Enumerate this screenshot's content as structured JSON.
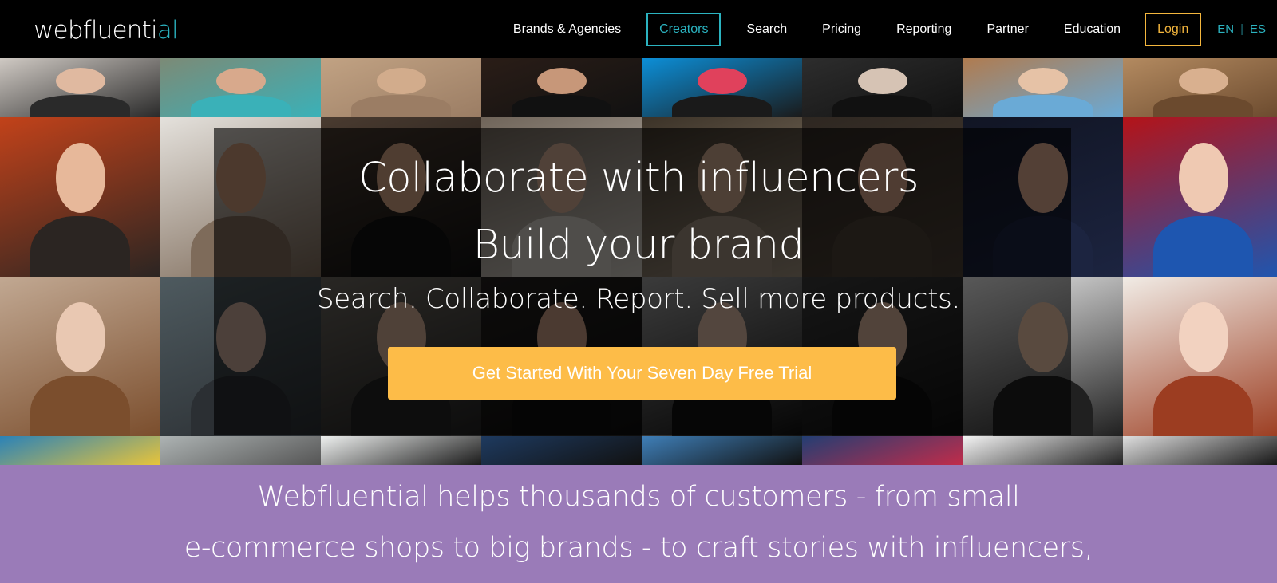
{
  "nav": {
    "logo_main": "webfluenti",
    "logo_accent": "al",
    "links": [
      "Brands & Agencies",
      "Creators",
      "Search",
      "Pricing",
      "Reporting",
      "Partner",
      "Education"
    ],
    "active_link": "Creators",
    "login_label": "Login",
    "languages": [
      "EN",
      "ES"
    ]
  },
  "hero": {
    "headline_1": "Collaborate with influencers",
    "headline_2": "Build your brand",
    "tagline": "Search. Collaborate. Report. Sell more products.",
    "cta_label": "Get Started With Your Seven Day Free Trial"
  },
  "band": {
    "line_1": "Webfluential helps thousands of customers - from small",
    "line_2": "e-commerce shops to big brands - to craft stories with influencers,"
  },
  "colors": {
    "accent": "#2bb3c0",
    "login": "#f4b63d",
    "cta": "#fdbc48",
    "band": "#9a7bb8"
  }
}
